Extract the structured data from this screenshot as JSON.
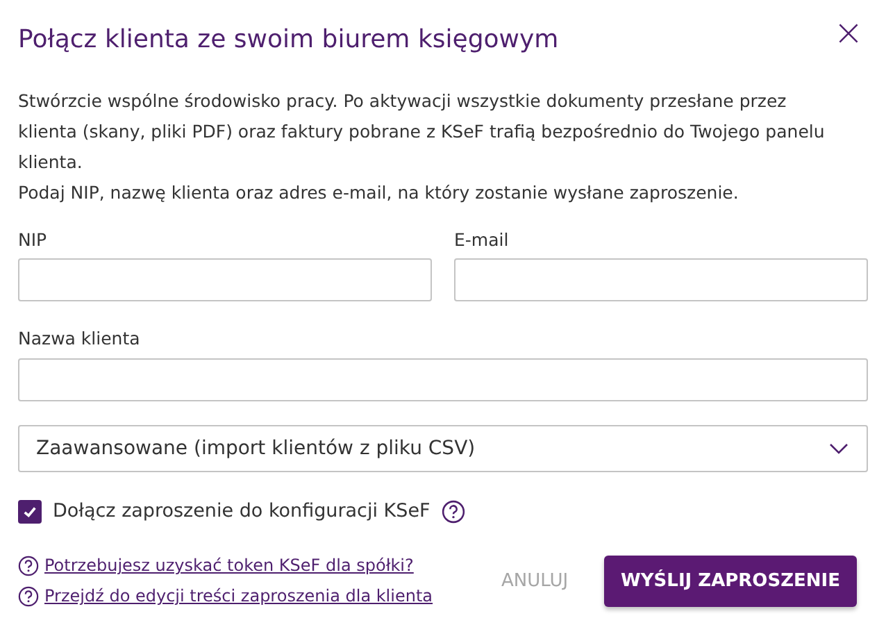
{
  "dialog": {
    "title": "Połącz klienta ze swoim biurem księgowym",
    "description": [
      "Stwórzcie wspólne środowisko pracy. Po aktywacji wszystkie dokumenty przesłane przez klienta (skany, pliki PDF) oraz faktury pobrane z KSeF trafią bezpośrednio do Twojego panelu klienta.",
      "Podaj NIP, nazwę klienta oraz adres e-mail, na który zostanie wysłane zaproszenie."
    ],
    "fields": [
      {
        "label": "NIP"
      },
      {
        "label": "E-mail"
      },
      {
        "label": "Nazwa klienta"
      }
    ],
    "advanced": {
      "label": "Zaawansowane (import klientów z pliku CSV)",
      "expanded": false
    },
    "checkbox": {
      "label": "Dołącz zaproszenie do konfiguracji KSeF",
      "checked": true
    },
    "links": [
      "Potrzebujesz uzyskać token KSeF dla spółki?",
      "Przejdź do edycji treści zaproszenia dla klienta"
    ],
    "buttons": [
      {
        "label": "ANULUJ",
        "kind": "secondary"
      },
      {
        "label": "WYŚLIJ ZAPROSZENIE",
        "kind": "primary"
      }
    ]
  }
}
